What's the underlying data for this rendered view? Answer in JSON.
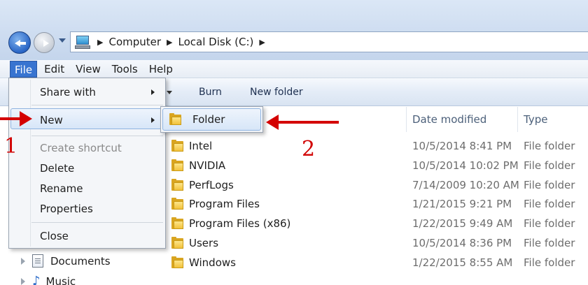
{
  "address_bar": {
    "crumbs": [
      "Computer",
      "Local Disk (C:)"
    ]
  },
  "menubar": {
    "items": [
      "File",
      "Edit",
      "View",
      "Tools",
      "Help"
    ]
  },
  "toolbar": {
    "burn_label": "Burn",
    "new_folder_label": "New folder"
  },
  "file_menu": {
    "share_with": "Share with",
    "new": "New",
    "create_shortcut": "Create shortcut",
    "delete": "Delete",
    "rename": "Rename",
    "properties": "Properties",
    "close": "Close"
  },
  "new_submenu": {
    "folder": "Folder"
  },
  "columns": {
    "date_modified": "Date modified",
    "type": "Type"
  },
  "files": [
    {
      "name": "Intel",
      "date": "10/5/2014 8:41 PM",
      "type": "File folder"
    },
    {
      "name": "NVIDIA",
      "date": "10/5/2014 10:02 PM",
      "type": "File folder"
    },
    {
      "name": "PerfLogs",
      "date": "7/14/2009 10:20 AM",
      "type": "File folder"
    },
    {
      "name": "Program Files",
      "date": "1/21/2015 9:21 PM",
      "type": "File folder"
    },
    {
      "name": "Program Files (x86)",
      "date": "1/22/2015 9:49 AM",
      "type": "File folder"
    },
    {
      "name": "Users",
      "date": "10/5/2014 8:36 PM",
      "type": "File folder"
    },
    {
      "name": "Windows",
      "date": "1/22/2015 8:55 AM",
      "type": "File folder"
    }
  ],
  "nav_pane": {
    "documents": "Documents",
    "music": "Music"
  },
  "annotations": {
    "step1": "1",
    "step2": "2"
  },
  "colors": {
    "annotation_red": "#d40000",
    "menu_highlight": "#3874d0",
    "folder_yellow": "#f2c23b"
  },
  "icons": [
    "back-arrow-icon",
    "forward-arrow-icon",
    "computer-icon",
    "folder-icon",
    "documents-icon",
    "music-icon",
    "submenu-arrow-icon"
  ]
}
